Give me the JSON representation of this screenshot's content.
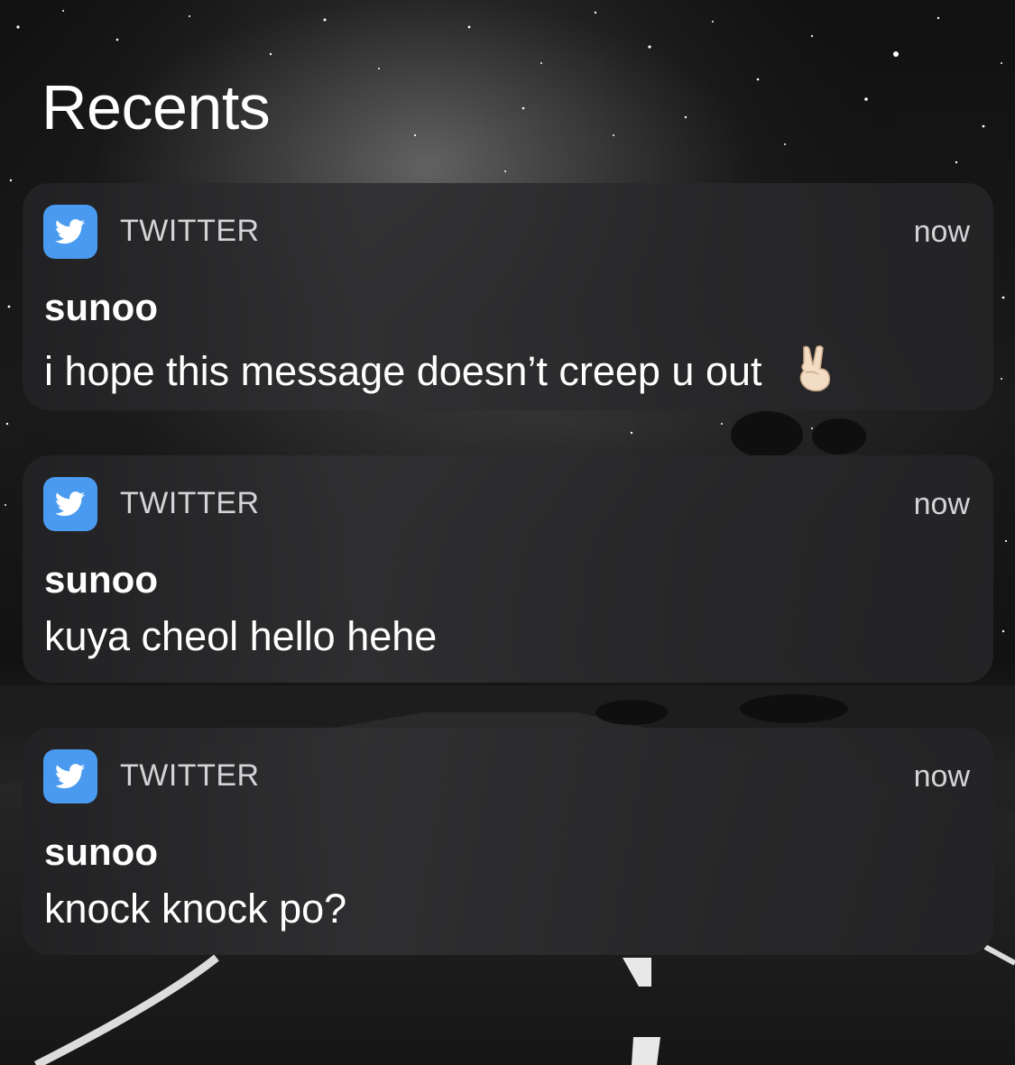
{
  "screen": {
    "title": "Recents"
  },
  "notifications": [
    {
      "app": "TWITTER",
      "icon": "twitter-bird-icon",
      "time": "now",
      "sender": "sunoo",
      "message": "i hope this message doesn’t creep u out",
      "emoji": "✌🏻"
    },
    {
      "app": "TWITTER",
      "icon": "twitter-bird-icon",
      "time": "now",
      "sender": "sunoo",
      "message": "kuya cheol hello hehe"
    },
    {
      "app": "TWITTER",
      "icon": "twitter-bird-icon",
      "time": "now",
      "sender": "sunoo",
      "message": "knock knock po?"
    }
  ],
  "colors": {
    "twitter_blue": "#4a9bf0",
    "card_background": "#2c2c2e",
    "text_primary": "#ffffff",
    "text_secondary": "#d4d4d6"
  }
}
